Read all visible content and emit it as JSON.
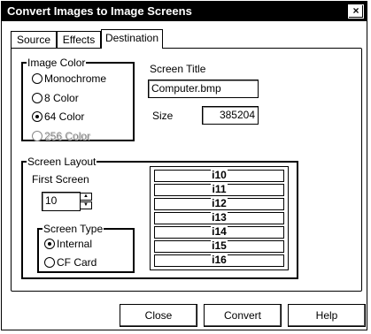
{
  "window": {
    "title": "Convert Images to Image Screens",
    "close_glyph": "×"
  },
  "tabs": [
    {
      "label": "Source",
      "active": false
    },
    {
      "label": "Effects",
      "active": false
    },
    {
      "label": "Destination",
      "active": true
    }
  ],
  "image_color": {
    "legend": "Image Color",
    "options": [
      {
        "label": "Monochrome",
        "selected": false,
        "enabled": true
      },
      {
        "label": "8 Color",
        "selected": false,
        "enabled": true
      },
      {
        "label": "64 Color",
        "selected": true,
        "enabled": true
      },
      {
        "label": "256 Color",
        "selected": false,
        "enabled": false
      }
    ]
  },
  "screen_title": {
    "label": "Screen Title",
    "value": "Computer.bmp"
  },
  "size": {
    "label": "Size",
    "value": "385204"
  },
  "screen_layout": {
    "legend": "Screen Layout",
    "first_screen_label": "First Screen",
    "first_screen_value": "10",
    "screen_type": {
      "legend": "Screen Type",
      "options": [
        {
          "label": "Internal",
          "selected": true
        },
        {
          "label": "CF Card",
          "selected": false
        }
      ]
    },
    "screens": [
      "i10",
      "i11",
      "i12",
      "i13",
      "i14",
      "i15",
      "i16"
    ]
  },
  "buttons": {
    "close": "Close",
    "convert": "Convert",
    "help": "Help"
  }
}
